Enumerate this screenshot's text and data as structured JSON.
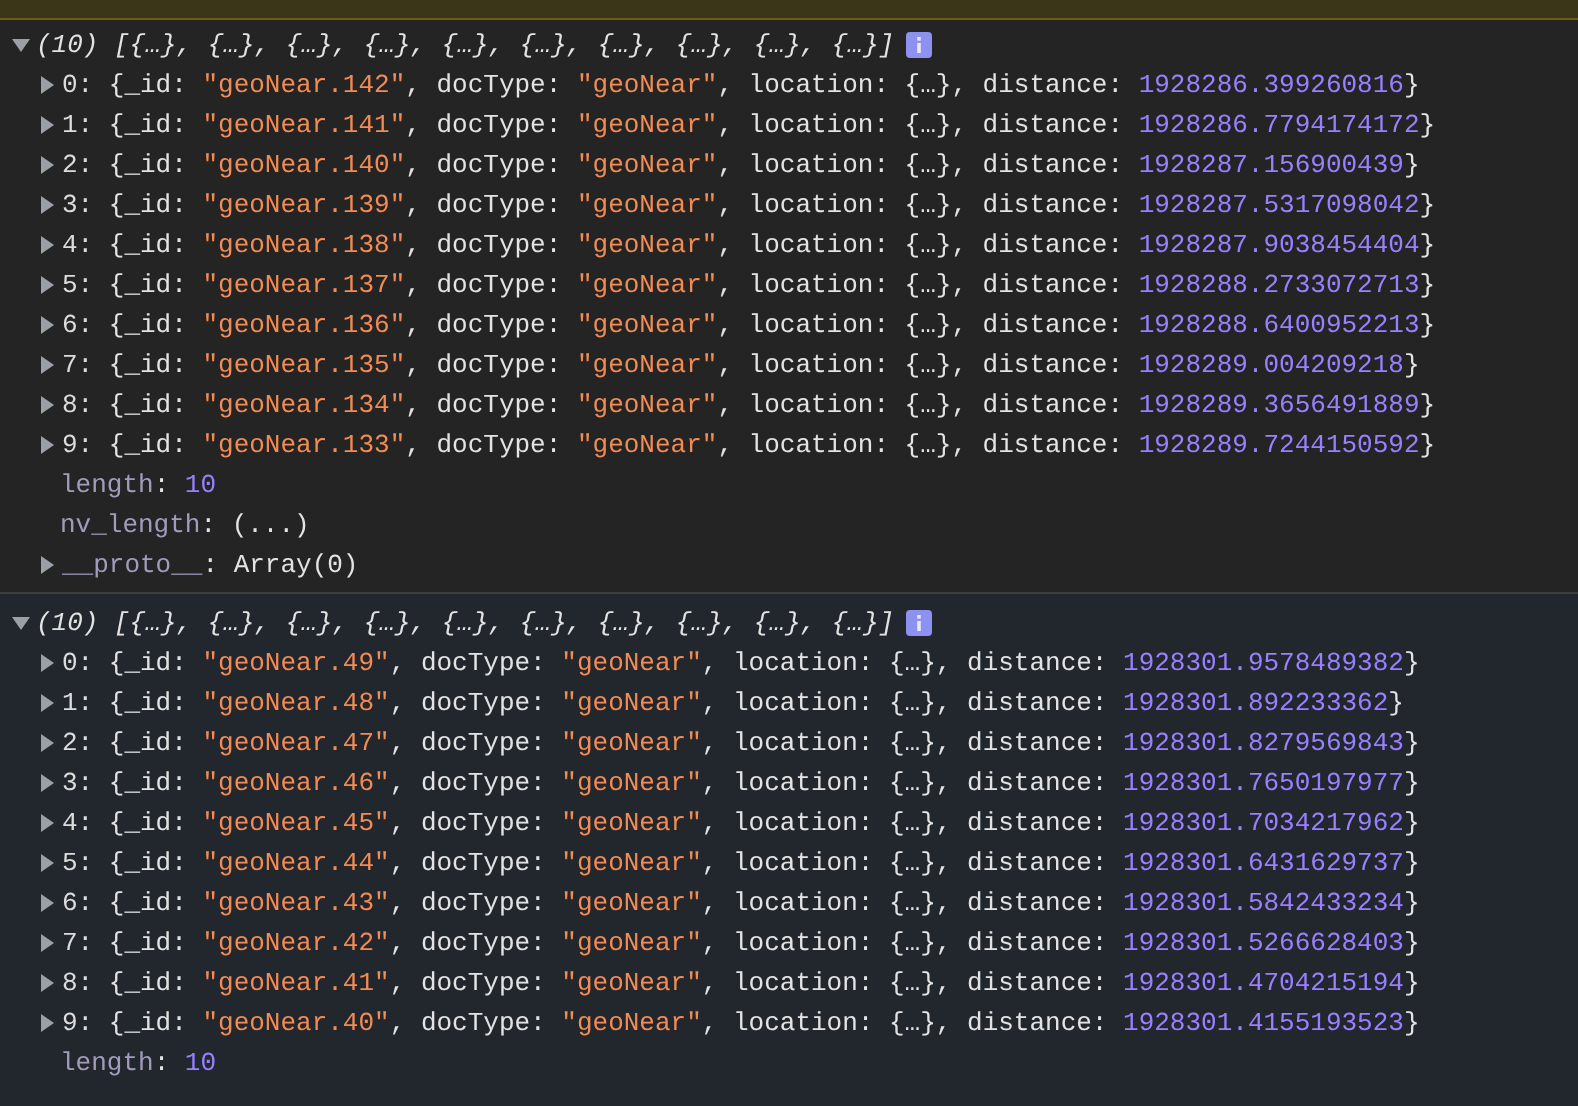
{
  "groups": [
    {
      "expanded": true,
      "summary": [
        {
          "text": "(10) [{…}, {…}, {…}, {…}, {…}, {…}, {…}, {…}, {…}, {…}]",
          "kind": "italic"
        }
      ],
      "items": [
        {
          "kind": "object",
          "expanded": false,
          "segments": [
            {
              "text": "0: ",
              "kind": "key"
            },
            {
              "text": "{_id: ",
              "kind": "plain"
            },
            {
              "text": "\"geoNear.142\"",
              "kind": "string"
            },
            {
              "text": ", docType: ",
              "kind": "plain"
            },
            {
              "text": "\"geoNear\"",
              "kind": "string"
            },
            {
              "text": ", location: {…}, distance: ",
              "kind": "plain"
            },
            {
              "text": "1928286.399260816",
              "kind": "number"
            },
            {
              "text": "}",
              "kind": "plain"
            }
          ]
        },
        {
          "kind": "object",
          "expanded": false,
          "segments": [
            {
              "text": "1: ",
              "kind": "key"
            },
            {
              "text": "{_id: ",
              "kind": "plain"
            },
            {
              "text": "\"geoNear.141\"",
              "kind": "string"
            },
            {
              "text": ", docType: ",
              "kind": "plain"
            },
            {
              "text": "\"geoNear\"",
              "kind": "string"
            },
            {
              "text": ", location: {…}, distance: ",
              "kind": "plain"
            },
            {
              "text": "1928286.7794174172",
              "kind": "number"
            },
            {
              "text": "}",
              "kind": "plain"
            }
          ]
        },
        {
          "kind": "object",
          "expanded": false,
          "segments": [
            {
              "text": "2: ",
              "kind": "key"
            },
            {
              "text": "{_id: ",
              "kind": "plain"
            },
            {
              "text": "\"geoNear.140\"",
              "kind": "string"
            },
            {
              "text": ", docType: ",
              "kind": "plain"
            },
            {
              "text": "\"geoNear\"",
              "kind": "string"
            },
            {
              "text": ", location: {…}, distance: ",
              "kind": "plain"
            },
            {
              "text": "1928287.156900439",
              "kind": "number"
            },
            {
              "text": "}",
              "kind": "plain"
            }
          ]
        },
        {
          "kind": "object",
          "expanded": false,
          "segments": [
            {
              "text": "3: ",
              "kind": "key"
            },
            {
              "text": "{_id: ",
              "kind": "plain"
            },
            {
              "text": "\"geoNear.139\"",
              "kind": "string"
            },
            {
              "text": ", docType: ",
              "kind": "plain"
            },
            {
              "text": "\"geoNear\"",
              "kind": "string"
            },
            {
              "text": ", location: {…}, distance: ",
              "kind": "plain"
            },
            {
              "text": "1928287.5317098042",
              "kind": "number"
            },
            {
              "text": "}",
              "kind": "plain"
            }
          ]
        },
        {
          "kind": "object",
          "expanded": false,
          "segments": [
            {
              "text": "4: ",
              "kind": "key"
            },
            {
              "text": "{_id: ",
              "kind": "plain"
            },
            {
              "text": "\"geoNear.138\"",
              "kind": "string"
            },
            {
              "text": ", docType: ",
              "kind": "plain"
            },
            {
              "text": "\"geoNear\"",
              "kind": "string"
            },
            {
              "text": ", location: {…}, distance: ",
              "kind": "plain"
            },
            {
              "text": "1928287.9038454404",
              "kind": "number"
            },
            {
              "text": "}",
              "kind": "plain"
            }
          ]
        },
        {
          "kind": "object",
          "expanded": false,
          "segments": [
            {
              "text": "5: ",
              "kind": "key"
            },
            {
              "text": "{_id: ",
              "kind": "plain"
            },
            {
              "text": "\"geoNear.137\"",
              "kind": "string"
            },
            {
              "text": ", docType: ",
              "kind": "plain"
            },
            {
              "text": "\"geoNear\"",
              "kind": "string"
            },
            {
              "text": ", location: {…}, distance: ",
              "kind": "plain"
            },
            {
              "text": "1928288.2733072713",
              "kind": "number"
            },
            {
              "text": "}",
              "kind": "plain"
            }
          ]
        },
        {
          "kind": "object",
          "expanded": false,
          "segments": [
            {
              "text": "6: ",
              "kind": "key"
            },
            {
              "text": "{_id: ",
              "kind": "plain"
            },
            {
              "text": "\"geoNear.136\"",
              "kind": "string"
            },
            {
              "text": ", docType: ",
              "kind": "plain"
            },
            {
              "text": "\"geoNear\"",
              "kind": "string"
            },
            {
              "text": ", location: {…}, distance: ",
              "kind": "plain"
            },
            {
              "text": "1928288.6400952213",
              "kind": "number"
            },
            {
              "text": "}",
              "kind": "plain"
            }
          ]
        },
        {
          "kind": "object",
          "expanded": false,
          "segments": [
            {
              "text": "7: ",
              "kind": "key"
            },
            {
              "text": "{_id: ",
              "kind": "plain"
            },
            {
              "text": "\"geoNear.135\"",
              "kind": "string"
            },
            {
              "text": ", docType: ",
              "kind": "plain"
            },
            {
              "text": "\"geoNear\"",
              "kind": "string"
            },
            {
              "text": ", location: {…}, distance: ",
              "kind": "plain"
            },
            {
              "text": "1928289.004209218",
              "kind": "number"
            },
            {
              "text": "}",
              "kind": "plain"
            }
          ]
        },
        {
          "kind": "object",
          "expanded": false,
          "segments": [
            {
              "text": "8: ",
              "kind": "key"
            },
            {
              "text": "{_id: ",
              "kind": "plain"
            },
            {
              "text": "\"geoNear.134\"",
              "kind": "string"
            },
            {
              "text": ", docType: ",
              "kind": "plain"
            },
            {
              "text": "\"geoNear\"",
              "kind": "string"
            },
            {
              "text": ", location: {…}, distance: ",
              "kind": "plain"
            },
            {
              "text": "1928289.3656491889",
              "kind": "number"
            },
            {
              "text": "}",
              "kind": "plain"
            }
          ]
        },
        {
          "kind": "object",
          "expanded": false,
          "segments": [
            {
              "text": "9: ",
              "kind": "key"
            },
            {
              "text": "{_id: ",
              "kind": "plain"
            },
            {
              "text": "\"geoNear.133\"",
              "kind": "string"
            },
            {
              "text": ", docType: ",
              "kind": "plain"
            },
            {
              "text": "\"geoNear\"",
              "kind": "string"
            },
            {
              "text": ", location: {…}, distance: ",
              "kind": "plain"
            },
            {
              "text": "1928289.7244150592",
              "kind": "number"
            },
            {
              "text": "}",
              "kind": "plain"
            }
          ]
        },
        {
          "kind": "property",
          "segments": [
            {
              "text": "length",
              "kind": "dim"
            },
            {
              "text": ": ",
              "kind": "plain"
            },
            {
              "text": "10",
              "kind": "number"
            }
          ]
        },
        {
          "kind": "property",
          "segments": [
            {
              "text": "nv_length",
              "kind": "dim"
            },
            {
              "text": ": (...)",
              "kind": "plain"
            }
          ]
        },
        {
          "kind": "object",
          "expanded": false,
          "segments": [
            {
              "text": "__proto__",
              "kind": "dim"
            },
            {
              "text": ": Array(0)",
              "kind": "plain"
            }
          ]
        }
      ]
    },
    {
      "expanded": true,
      "summary": [
        {
          "text": "(10) [{…}, {…}, {…}, {…}, {…}, {…}, {…}, {…}, {…}, {…}]",
          "kind": "italic"
        }
      ],
      "items": [
        {
          "kind": "object",
          "expanded": false,
          "segments": [
            {
              "text": "0: ",
              "kind": "key"
            },
            {
              "text": "{_id: ",
              "kind": "plain"
            },
            {
              "text": "\"geoNear.49\"",
              "kind": "string"
            },
            {
              "text": ", docType: ",
              "kind": "plain"
            },
            {
              "text": "\"geoNear\"",
              "kind": "string"
            },
            {
              "text": ", location: {…}, distance: ",
              "kind": "plain"
            },
            {
              "text": "1928301.9578489382",
              "kind": "number"
            },
            {
              "text": "}",
              "kind": "plain"
            }
          ]
        },
        {
          "kind": "object",
          "expanded": false,
          "segments": [
            {
              "text": "1: ",
              "kind": "key"
            },
            {
              "text": "{_id: ",
              "kind": "plain"
            },
            {
              "text": "\"geoNear.48\"",
              "kind": "string"
            },
            {
              "text": ", docType: ",
              "kind": "plain"
            },
            {
              "text": "\"geoNear\"",
              "kind": "string"
            },
            {
              "text": ", location: {…}, distance: ",
              "kind": "plain"
            },
            {
              "text": "1928301.892233362",
              "kind": "number"
            },
            {
              "text": "}",
              "kind": "plain"
            }
          ]
        },
        {
          "kind": "object",
          "expanded": false,
          "segments": [
            {
              "text": "2: ",
              "kind": "key"
            },
            {
              "text": "{_id: ",
              "kind": "plain"
            },
            {
              "text": "\"geoNear.47\"",
              "kind": "string"
            },
            {
              "text": ", docType: ",
              "kind": "plain"
            },
            {
              "text": "\"geoNear\"",
              "kind": "string"
            },
            {
              "text": ", location: {…}, distance: ",
              "kind": "plain"
            },
            {
              "text": "1928301.8279569843",
              "kind": "number"
            },
            {
              "text": "}",
              "kind": "plain"
            }
          ]
        },
        {
          "kind": "object",
          "expanded": false,
          "segments": [
            {
              "text": "3: ",
              "kind": "key"
            },
            {
              "text": "{_id: ",
              "kind": "plain"
            },
            {
              "text": "\"geoNear.46\"",
              "kind": "string"
            },
            {
              "text": ", docType: ",
              "kind": "plain"
            },
            {
              "text": "\"geoNear\"",
              "kind": "string"
            },
            {
              "text": ", location: {…}, distance: ",
              "kind": "plain"
            },
            {
              "text": "1928301.7650197977",
              "kind": "number"
            },
            {
              "text": "}",
              "kind": "plain"
            }
          ]
        },
        {
          "kind": "object",
          "expanded": false,
          "segments": [
            {
              "text": "4: ",
              "kind": "key"
            },
            {
              "text": "{_id: ",
              "kind": "plain"
            },
            {
              "text": "\"geoNear.45\"",
              "kind": "string"
            },
            {
              "text": ", docType: ",
              "kind": "plain"
            },
            {
              "text": "\"geoNear\"",
              "kind": "string"
            },
            {
              "text": ", location: {…}, distance: ",
              "kind": "plain"
            },
            {
              "text": "1928301.7034217962",
              "kind": "number"
            },
            {
              "text": "}",
              "kind": "plain"
            }
          ]
        },
        {
          "kind": "object",
          "expanded": false,
          "segments": [
            {
              "text": "5: ",
              "kind": "key"
            },
            {
              "text": "{_id: ",
              "kind": "plain"
            },
            {
              "text": "\"geoNear.44\"",
              "kind": "string"
            },
            {
              "text": ", docType: ",
              "kind": "plain"
            },
            {
              "text": "\"geoNear\"",
              "kind": "string"
            },
            {
              "text": ", location: {…}, distance: ",
              "kind": "plain"
            },
            {
              "text": "1928301.6431629737",
              "kind": "number"
            },
            {
              "text": "}",
              "kind": "plain"
            }
          ]
        },
        {
          "kind": "object",
          "expanded": false,
          "segments": [
            {
              "text": "6: ",
              "kind": "key"
            },
            {
              "text": "{_id: ",
              "kind": "plain"
            },
            {
              "text": "\"geoNear.43\"",
              "kind": "string"
            },
            {
              "text": ", docType: ",
              "kind": "plain"
            },
            {
              "text": "\"geoNear\"",
              "kind": "string"
            },
            {
              "text": ", location: {…}, distance: ",
              "kind": "plain"
            },
            {
              "text": "1928301.5842433234",
              "kind": "number"
            },
            {
              "text": "}",
              "kind": "plain"
            }
          ]
        },
        {
          "kind": "object",
          "expanded": false,
          "segments": [
            {
              "text": "7: ",
              "kind": "key"
            },
            {
              "text": "{_id: ",
              "kind": "plain"
            },
            {
              "text": "\"geoNear.42\"",
              "kind": "string"
            },
            {
              "text": ", docType: ",
              "kind": "plain"
            },
            {
              "text": "\"geoNear\"",
              "kind": "string"
            },
            {
              "text": ", location: {…}, distance: ",
              "kind": "plain"
            },
            {
              "text": "1928301.5266628403",
              "kind": "number"
            },
            {
              "text": "}",
              "kind": "plain"
            }
          ]
        },
        {
          "kind": "object",
          "expanded": false,
          "segments": [
            {
              "text": "8: ",
              "kind": "key"
            },
            {
              "text": "{_id: ",
              "kind": "plain"
            },
            {
              "text": "\"geoNear.41\"",
              "kind": "string"
            },
            {
              "text": ", docType: ",
              "kind": "plain"
            },
            {
              "text": "\"geoNear\"",
              "kind": "string"
            },
            {
              "text": ", location: {…}, distance: ",
              "kind": "plain"
            },
            {
              "text": "1928301.4704215194",
              "kind": "number"
            },
            {
              "text": "}",
              "kind": "plain"
            }
          ]
        },
        {
          "kind": "object",
          "expanded": false,
          "segments": [
            {
              "text": "9: ",
              "kind": "key"
            },
            {
              "text": "{_id: ",
              "kind": "plain"
            },
            {
              "text": "\"geoNear.40\"",
              "kind": "string"
            },
            {
              "text": ", docType: ",
              "kind": "plain"
            },
            {
              "text": "\"geoNear\"",
              "kind": "string"
            },
            {
              "text": ", location: {…}, distance: ",
              "kind": "plain"
            },
            {
              "text": "1928301.4155193523",
              "kind": "number"
            },
            {
              "text": "}",
              "kind": "plain"
            }
          ]
        },
        {
          "kind": "property",
          "segments": [
            {
              "text": "length",
              "kind": "dim"
            },
            {
              "text": ": ",
              "kind": "plain"
            },
            {
              "text": "10",
              "kind": "number"
            }
          ]
        }
      ]
    }
  ]
}
